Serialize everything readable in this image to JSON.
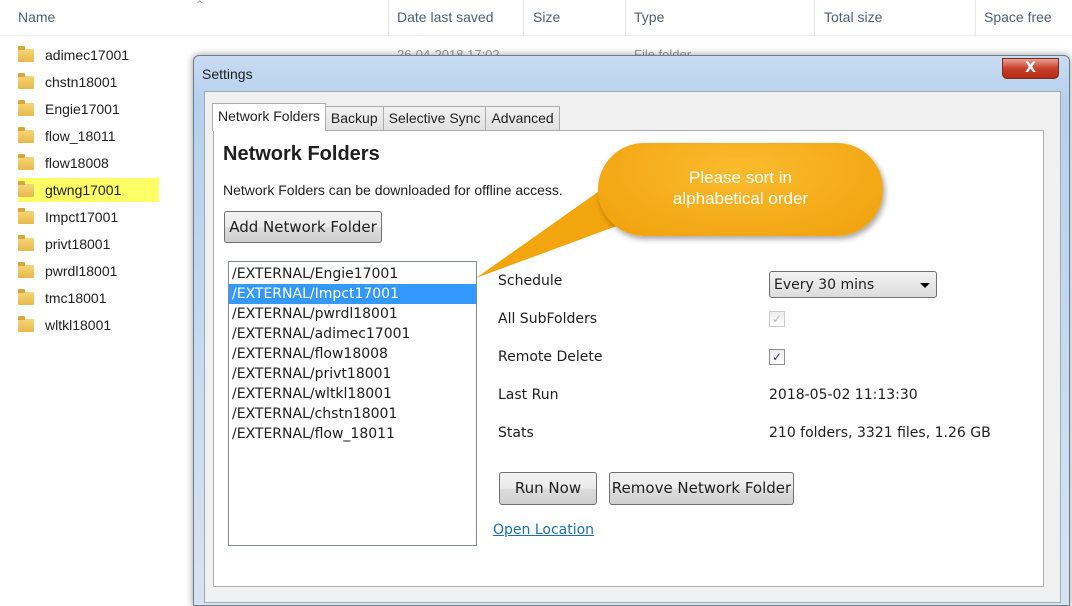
{
  "explorer": {
    "columns": [
      "Name",
      "Date last saved",
      "Size",
      "Type",
      "Total size",
      "Space free"
    ],
    "files": [
      "adimec17001",
      "chstn18001",
      "Engie17001",
      "flow_18011",
      "flow18008",
      "gtwng17001",
      "Impct17001",
      "privt18001",
      "pwrdl18001",
      "tmc18001",
      "wltkl18001"
    ],
    "highlighted": "gtwng17001",
    "background_row": {
      "date": "26-04-2018 17:02",
      "type": "File folder"
    }
  },
  "dialog": {
    "title": "Settings",
    "close_label": "X",
    "tabs": [
      "Network Folders",
      "Backup",
      "Selective Sync",
      "Advanced"
    ],
    "active_tab": "Network Folders",
    "heading": "Network Folders",
    "description": "Network Folders can be downloaded for offline access.",
    "add_button": "Add Network Folder",
    "folders": [
      "/EXTERNAL/Engie17001",
      "/EXTERNAL/Impct17001",
      "/EXTERNAL/pwrdl18001",
      "/EXTERNAL/adimec17001",
      "/EXTERNAL/flow18008",
      "/EXTERNAL/privt18001",
      "/EXTERNAL/wltkl18001",
      "/EXTERNAL/chstn18001",
      "/EXTERNAL/flow_18011"
    ],
    "selected_folder": "/EXTERNAL/Impct17001",
    "details": {
      "schedule_label": "Schedule",
      "schedule_value": "Every 30 mins",
      "subfolders_label": "All SubFolders",
      "subfolders_checked": true,
      "remote_delete_label": "Remote Delete",
      "remote_delete_checked": true,
      "last_run_label": "Last Run",
      "last_run_value": "2018-05-02 11:13:30",
      "stats_label": "Stats",
      "stats_value": "210 folders, 3321 files, 1.26 GB"
    },
    "run_now": "Run Now",
    "remove_button": "Remove Network Folder",
    "open_location": "Open Location"
  },
  "callout": {
    "line1": "Please sort in",
    "line2": "alphabetical order",
    "color": "#f4a80c"
  }
}
